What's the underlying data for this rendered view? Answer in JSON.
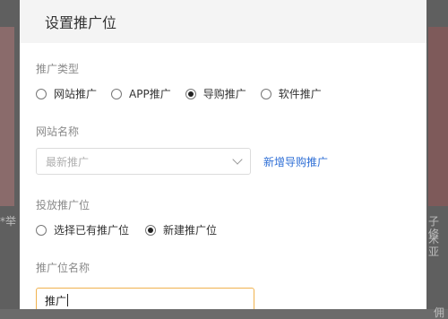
{
  "backdrop": {
    "left_text": "*举",
    "right_text_1": "子修",
    "right_text_2": "米亚",
    "right_text_3": "佣"
  },
  "modal": {
    "title": "设置推广位",
    "promotion_type": {
      "label": "推广类型",
      "options": [
        {
          "label": "网站推广",
          "checked": false
        },
        {
          "label": "APP推广",
          "checked": false
        },
        {
          "label": "导购推广",
          "checked": true
        },
        {
          "label": "软件推广",
          "checked": false
        }
      ]
    },
    "site_name": {
      "label": "网站名称",
      "placeholder": "最新推广",
      "add_link": "新增导购推广"
    },
    "placement": {
      "label": "投放推广位",
      "options": [
        {
          "label": "选择已有推广位",
          "checked": false
        },
        {
          "label": "新建推广位",
          "checked": true
        }
      ]
    },
    "placement_name": {
      "label": "推广位名称",
      "value": "推广"
    }
  }
}
